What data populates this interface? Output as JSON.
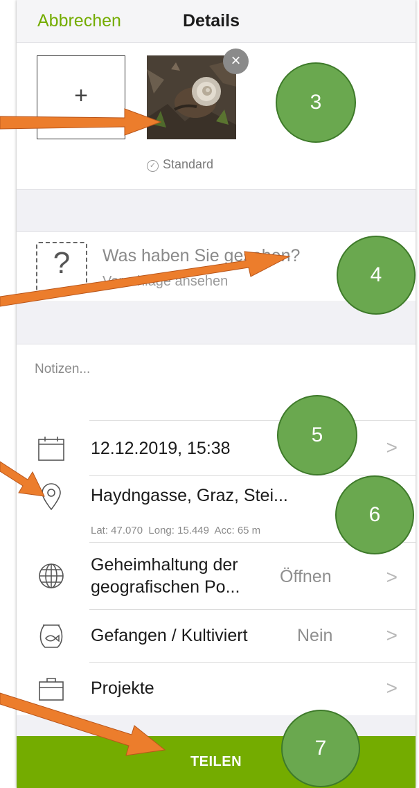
{
  "header": {
    "cancel_label": "Abbrechen",
    "title": "Details"
  },
  "photos": {
    "add_symbol": "+",
    "remove_symbol": "×",
    "default_label": "Standard",
    "default_check": "✓"
  },
  "species": {
    "icon_symbol": "?",
    "title": "Was haben Sie gesehen?",
    "subtitle": "Vorschläge ansehen"
  },
  "notes": {
    "placeholder": "Notizen..."
  },
  "details": {
    "date": {
      "label": "12.12.2019, 15:38",
      "chevron": ">"
    },
    "location": {
      "label": "Haydngasse, Graz, Stei...",
      "coords": "Lat: 47.070  Long: 15.449  Acc: 65 m",
      "chevron": ">"
    },
    "obscure": {
      "label_line1": "Geheimhaltung der",
      "label_line2": "geografischen Po...",
      "value": "Öffnen",
      "chevron": ">"
    },
    "captive": {
      "label": "Gefangen / Kultiviert",
      "value": "Nein",
      "chevron": ">"
    },
    "projects": {
      "label": "Projekte",
      "chevron": ">"
    }
  },
  "share_button": {
    "label": "TEILEN"
  },
  "badges": [
    "3",
    "4",
    "5",
    "6",
    "7"
  ],
  "colors": {
    "accent": "#74ac00",
    "badge": "#6aa84f",
    "arrow": "#ec7d2c",
    "header_bg": "#f5f5f7"
  },
  "icons": [
    "plus-icon",
    "close-icon",
    "check-icon",
    "question-icon",
    "calendar-icon",
    "map-pin-icon",
    "globe-icon",
    "fishbowl-icon",
    "briefcase-icon",
    "chevron-right-icon"
  ]
}
